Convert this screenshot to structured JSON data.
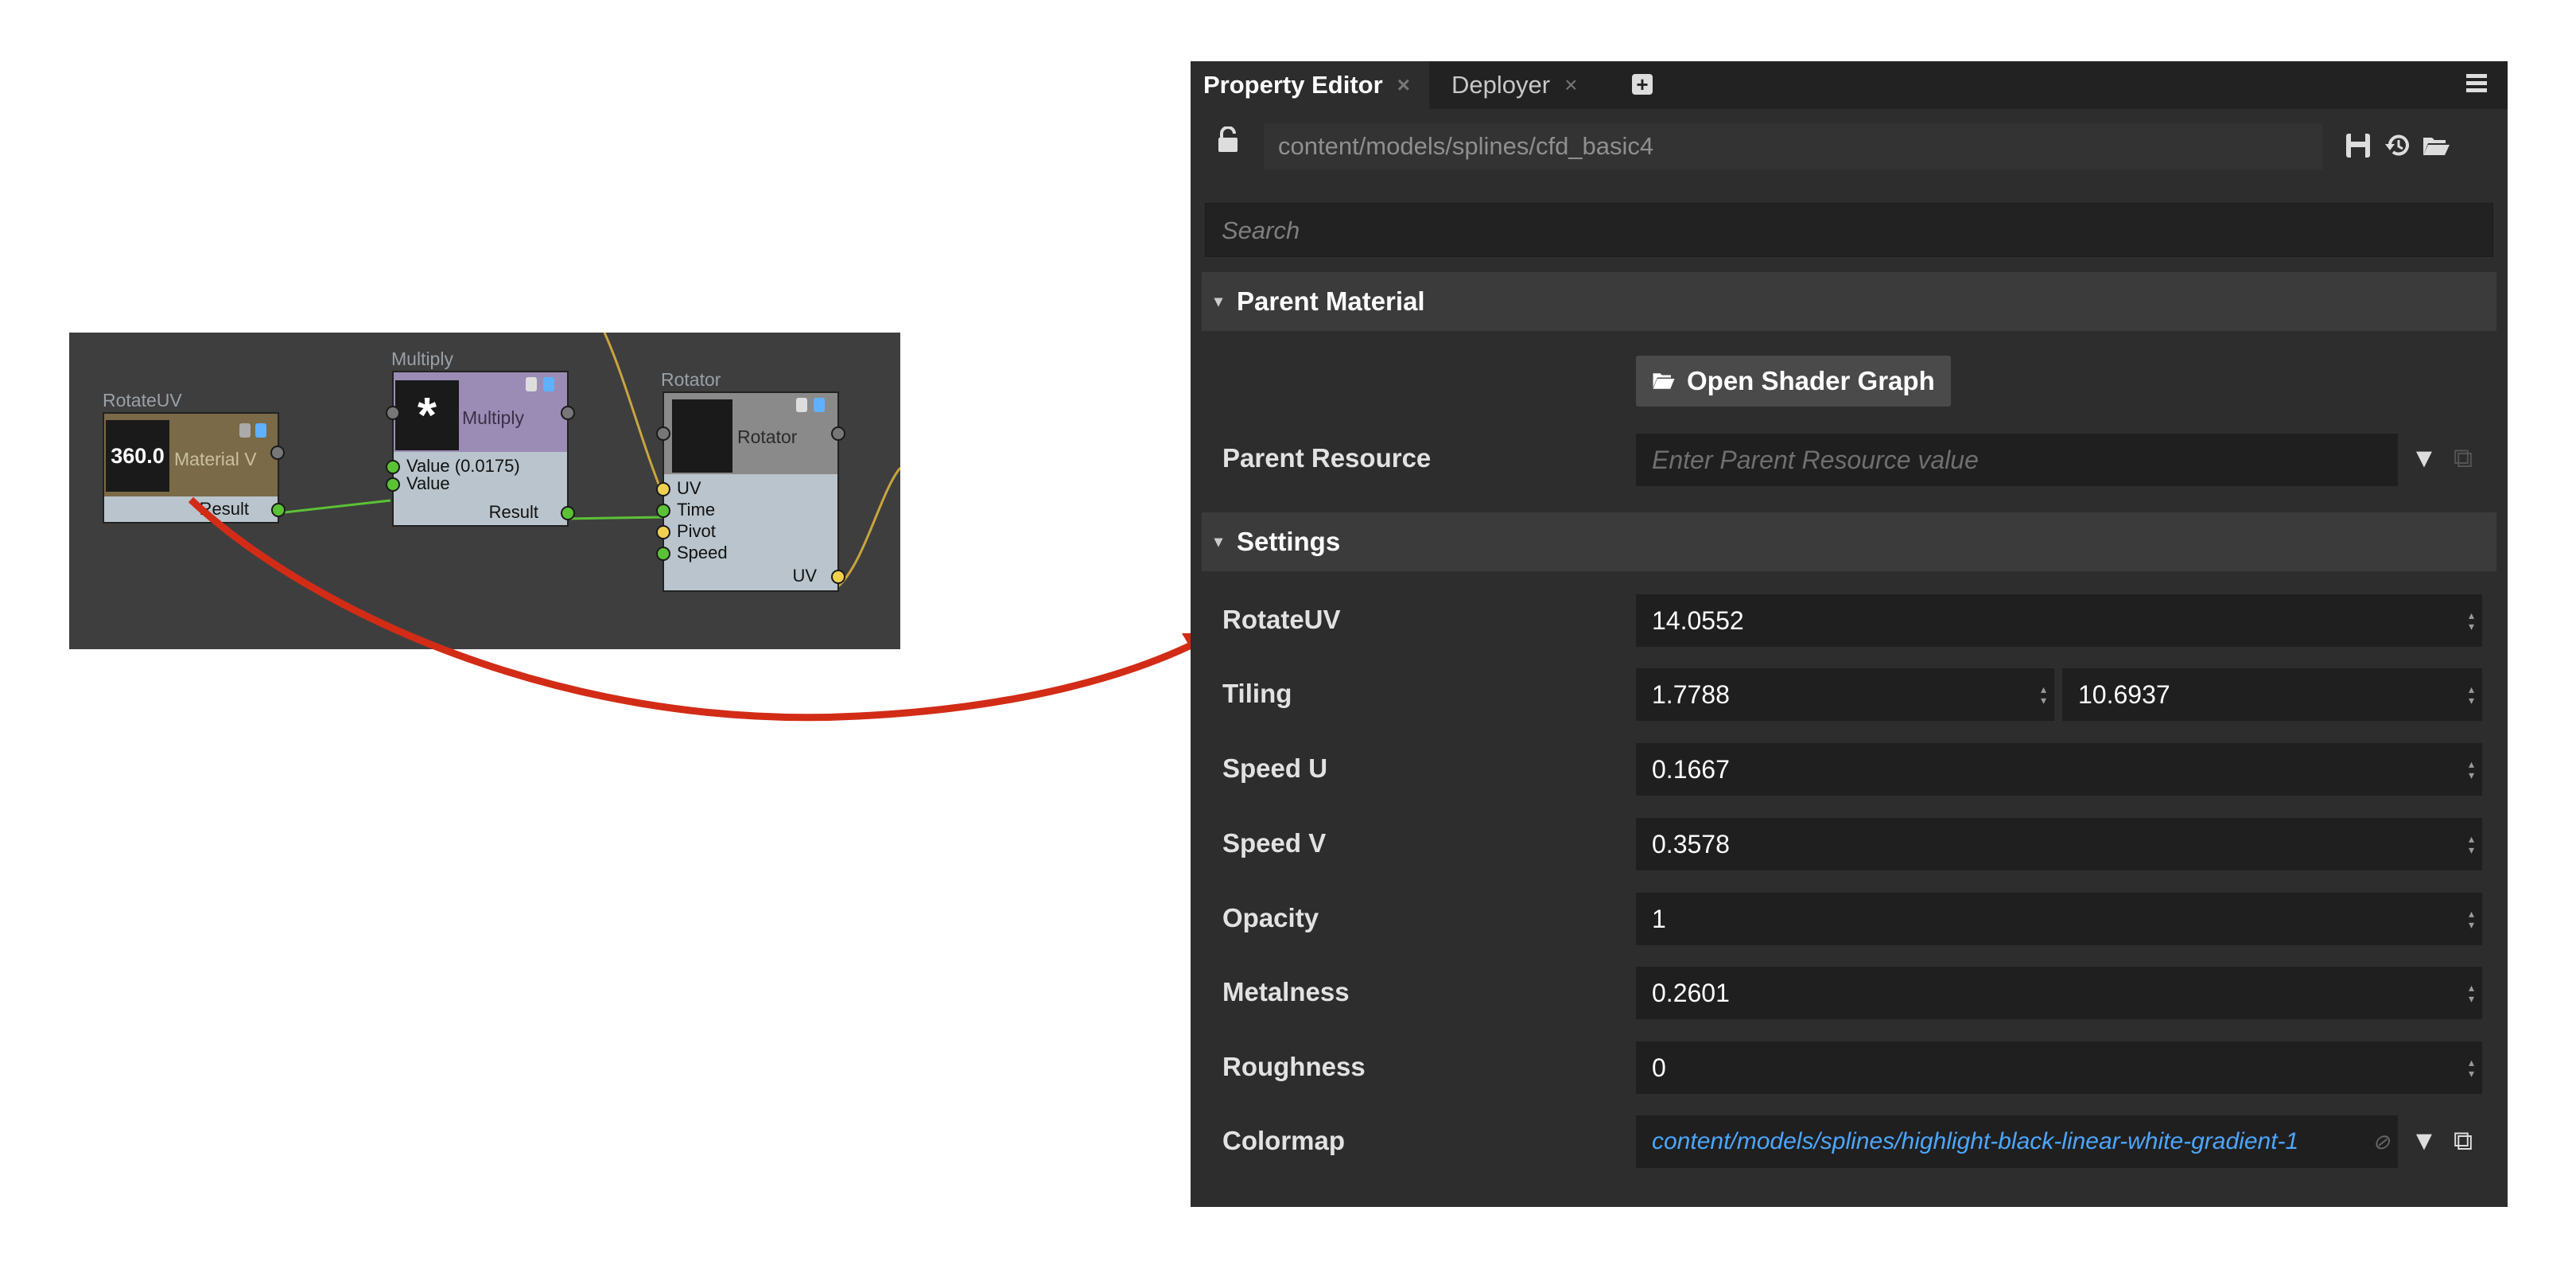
{
  "graph": {
    "rotateuv_node": {
      "title": "RotateUV",
      "thumb_value": "360.0",
      "label": "Material V",
      "output": "Result"
    },
    "multiply_node": {
      "title": "Multiply",
      "label": "Multiply",
      "thumb_symbol": "*",
      "inputs": [
        "Value (0.0175)",
        "Value"
      ],
      "output": "Result"
    },
    "rotator_node": {
      "title": "Rotator",
      "label": "Rotator",
      "inputs": [
        "UV",
        "Time",
        "Pivot",
        "Speed"
      ],
      "output": "UV"
    }
  },
  "arrow_color": "#d22c17",
  "editor": {
    "tabs": [
      {
        "label": "Property Editor",
        "active": true
      },
      {
        "label": "Deployer",
        "active": false
      }
    ],
    "close_glyph": "×",
    "add_tab_glyph": "+",
    "path": "content/models/splines/cfd_basic4",
    "search_placeholder": "Search",
    "parent_material": {
      "section_title": "Parent Material",
      "open_button": "Open Shader Graph",
      "parent_resource_label": "Parent Resource",
      "parent_resource_placeholder": "Enter Parent Resource value"
    },
    "settings": {
      "section_title": "Settings",
      "rotateuv": {
        "label": "RotateUV",
        "value": "14.0552"
      },
      "tiling": {
        "label": "Tiling",
        "x": "1.7788",
        "y": "10.6937"
      },
      "speed_u": {
        "label": "Speed U",
        "value": "0.1667"
      },
      "speed_v": {
        "label": "Speed V",
        "value": "0.3578"
      },
      "opacity": {
        "label": "Opacity",
        "value": "1"
      },
      "metalness": {
        "label": "Metalness",
        "value": "0.2601"
      },
      "roughness": {
        "label": "Roughness",
        "value": "0"
      },
      "colormap": {
        "label": "Colormap",
        "value": "content/models/splines/highlight-black-linear-white-gradient-1"
      }
    },
    "colors": {
      "panel_bg": "#2d2d2d",
      "field_bg": "#1f1f1f",
      "link": "#4ca6ff"
    }
  }
}
